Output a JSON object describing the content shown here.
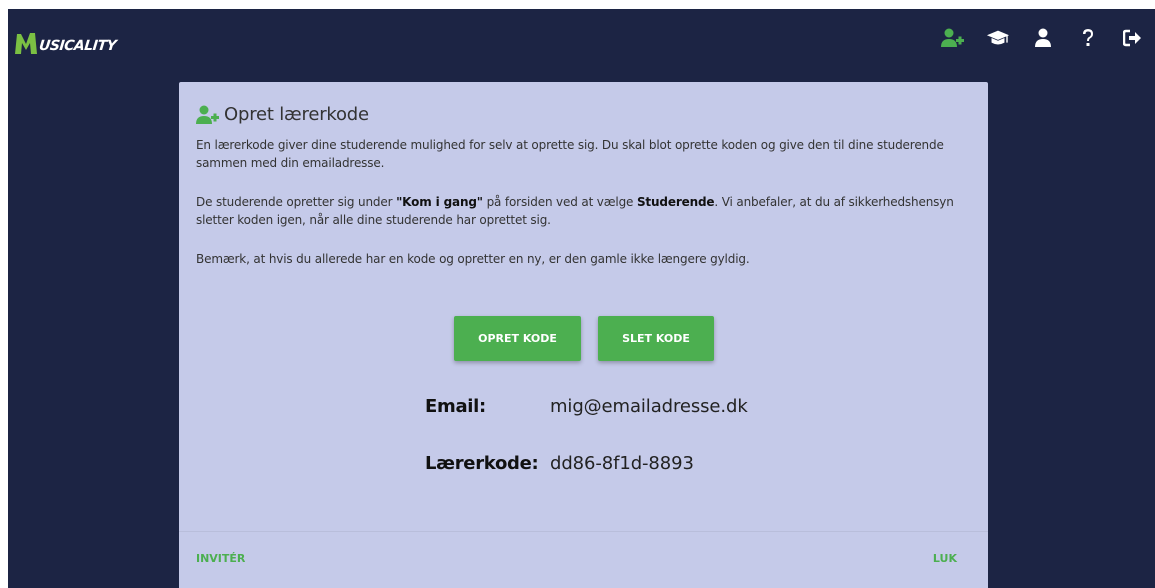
{
  "app": {
    "logo_text": "USICALITY"
  },
  "nav": {
    "icons": [
      "add-user-icon",
      "graduation-cap-icon",
      "user-icon",
      "question-icon",
      "sign-out-icon"
    ]
  },
  "colors": {
    "background": "#1c2444",
    "dialog": "#c5cae9",
    "accent": "#4caf50"
  },
  "dialog": {
    "title": "Opret lærerkode",
    "para1": "En lærerkode giver dine studerende mulighed for selv at oprette sig. Du skal blot oprette koden og give den til dine studerende sammen med din emailadresse.",
    "para2_pre": "De studerende opretter sig under ",
    "para2_bold1": "\"Kom i gang\"",
    "para2_mid": " på forsiden ved at vælge ",
    "para2_bold2": "Studerende",
    "para2_post": ". Vi anbefaler, at du af sikkerhedshensyn sletter koden igen, når alle dine studerende har oprettet sig.",
    "para3": "Bemærk, at hvis du allerede har en kode og opretter en ny, er den gamle ikke længere gyldig.",
    "create_button": "OPRET KODE",
    "delete_button": "SLET KODE",
    "email_label": "Email:",
    "email_value": "mig@emailadresse.dk",
    "code_label": "Lærerkode:",
    "code_value": "dd86-8f1d-8893",
    "invite_link": "INVITÉR",
    "close_link": "LUK"
  }
}
